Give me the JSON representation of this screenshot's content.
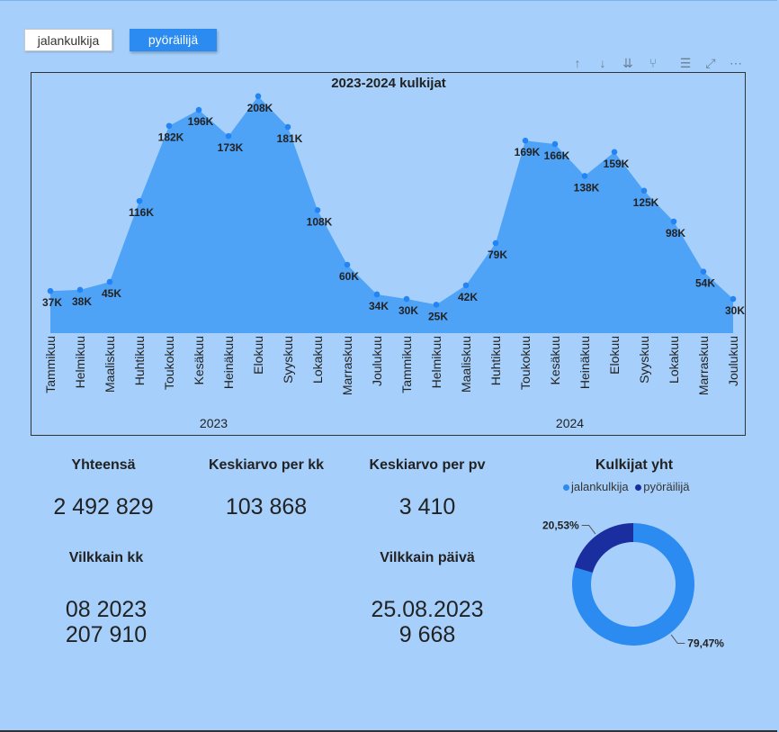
{
  "filters": {
    "walk_label": "jalankulkija",
    "bike_label": "pyöräilijä"
  },
  "toolbar_icons": [
    "arrow-up-icon",
    "arrow-down-icon",
    "double-arrow-down-icon",
    "expand-hierarchy-icon",
    "filter-icon",
    "focus-mode-icon",
    "more-options-icon"
  ],
  "chart_data": {
    "type": "area",
    "title": "2023-2024 kulkijat",
    "categories": [
      "Tammikuu",
      "Helmikuu",
      "Maaliskuu",
      "Huhtikuu",
      "Toukokuu",
      "Kesäkuu",
      "Heinäkuu",
      "Elokuu",
      "Syyskuu",
      "Lokakuu",
      "Marraskuu",
      "Joulukuu",
      "Tammikuu",
      "Helmikuu",
      "Maaliskuu",
      "Huhtikuu",
      "Toukokuu",
      "Kesäkuu",
      "Heinäkuu",
      "Elokuu",
      "Syyskuu",
      "Lokakuu",
      "Marraskuu",
      "Joulukuu"
    ],
    "groups": [
      "2023",
      "2024"
    ],
    "values": [
      37,
      38,
      45,
      116,
      182,
      196,
      173,
      208,
      181,
      108,
      60,
      34,
      30,
      25,
      42,
      79,
      169,
      166,
      138,
      159,
      125,
      98,
      54,
      30
    ],
    "labels": [
      "37K",
      "38K",
      "45K",
      "116K",
      "182K",
      "196K",
      "173K",
      "208K",
      "181K",
      "108K",
      "60K",
      "34K",
      "30K",
      "25K",
      "42K",
      "79K",
      "169K",
      "166K",
      "138K",
      "159K",
      "125K",
      "98K",
      "54K",
      "30K"
    ],
    "ylim": [
      0,
      215
    ],
    "area_color": "#4fa3f7",
    "point_color": "#2384f5",
    "grid": false
  },
  "kpis": {
    "total_title": "Yhteensä",
    "total_value": "2 492 829",
    "avg_month_title": "Keskiarvo per kk",
    "avg_month_value": "103 868",
    "avg_day_title": "Keskiarvo per pv",
    "avg_day_value": "3 410",
    "busiest_month_title": "Vilkkain kk",
    "busiest_month_date": "08 2023",
    "busiest_month_value": "207 910",
    "busiest_day_title": "Vilkkain päivä",
    "busiest_day_date": "25.08.2023",
    "busiest_day_value": "9 668"
  },
  "donut": {
    "title": "Kulkijat yht",
    "legend": [
      {
        "name": "jalankulkija",
        "color": "#2b8bf0"
      },
      {
        "name": "pyöräilijä",
        "color": "#1a2ea0"
      }
    ],
    "slices": [
      {
        "name": "jalankulkija",
        "value": 79.47,
        "label": "79,47%",
        "color": "#2b8bf0"
      },
      {
        "name": "pyöräilijä",
        "value": 20.53,
        "label": "20,53%",
        "color": "#1a2ea0"
      }
    ]
  }
}
